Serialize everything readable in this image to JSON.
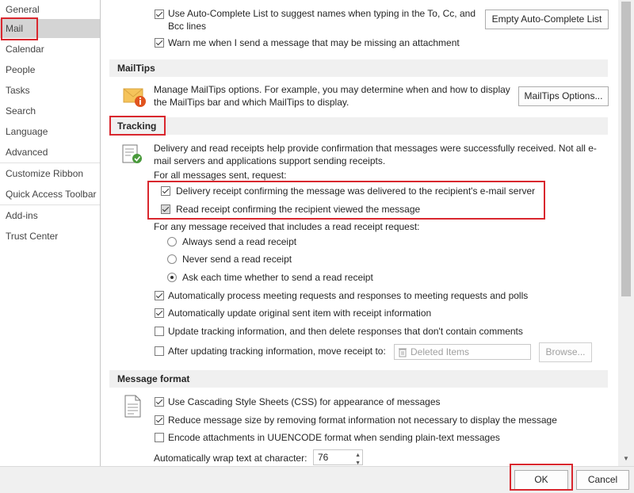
{
  "sidebar": {
    "items": [
      {
        "label": "General"
      },
      {
        "label": "Mail"
      },
      {
        "label": "Calendar"
      },
      {
        "label": "People"
      },
      {
        "label": "Tasks"
      },
      {
        "label": "Search"
      },
      {
        "label": "Language"
      },
      {
        "label": "Advanced"
      },
      {
        "label": "Customize Ribbon"
      },
      {
        "label": "Quick Access Toolbar"
      },
      {
        "label": "Add-ins"
      },
      {
        "label": "Trust Center"
      }
    ]
  },
  "compose": {
    "autocomplete_label": "Use Auto-Complete List to suggest names when typing in the To, Cc, and Bcc lines",
    "empty_autocomplete_button": "Empty Auto-Complete List",
    "attachment_warning_label": "Warn me when I send a message that may be missing an attachment"
  },
  "mailtips": {
    "header": "MailTips",
    "description": "Manage MailTips options. For example, you may determine when and how to display the MailTips bar and which MailTips to display.",
    "options_button": "MailTips Options..."
  },
  "tracking": {
    "header": "Tracking",
    "description": "Delivery and read receipts help provide confirmation that messages were successfully received. Not all e-mail servers and applications support sending receipts.",
    "for_all_label": "For all messages sent, request:",
    "delivery_receipt_label": "Delivery receipt confirming the message was delivered to the recipient's e-mail server",
    "read_receipt_label": "Read receipt confirming the recipient viewed the message",
    "any_message_label": "For any message received that includes a read receipt request:",
    "radio_always": "Always send a read receipt",
    "radio_never": "Never send a read receipt",
    "radio_ask": "Ask each time whether to send a read receipt",
    "auto_process_label": "Automatically process meeting requests and responses to meeting requests and polls",
    "auto_update_label": "Automatically update original sent item with receipt information",
    "update_delete_label": "Update tracking information, and then delete responses that don't contain comments",
    "move_receipt_label": "After updating tracking information, move receipt to:",
    "folder_value": "Deleted Items",
    "browse_button": "Browse..."
  },
  "message_format": {
    "header": "Message format",
    "css_label": "Use Cascading Style Sheets (CSS) for appearance of messages",
    "reduce_size_label": "Reduce message size by removing format information not necessary to display the message",
    "uuencode_label": "Encode attachments in UUENCODE format when sending plain-text messages",
    "wrap_label": "Automatically wrap text at character:",
    "wrap_value": "76"
  },
  "footer": {
    "ok_button": "OK",
    "cancel_button": "Cancel"
  },
  "colors": {
    "highlight_red": "#d9272e",
    "section_bg": "#f0f0f0",
    "selected_nav": "#d4d4d4"
  }
}
